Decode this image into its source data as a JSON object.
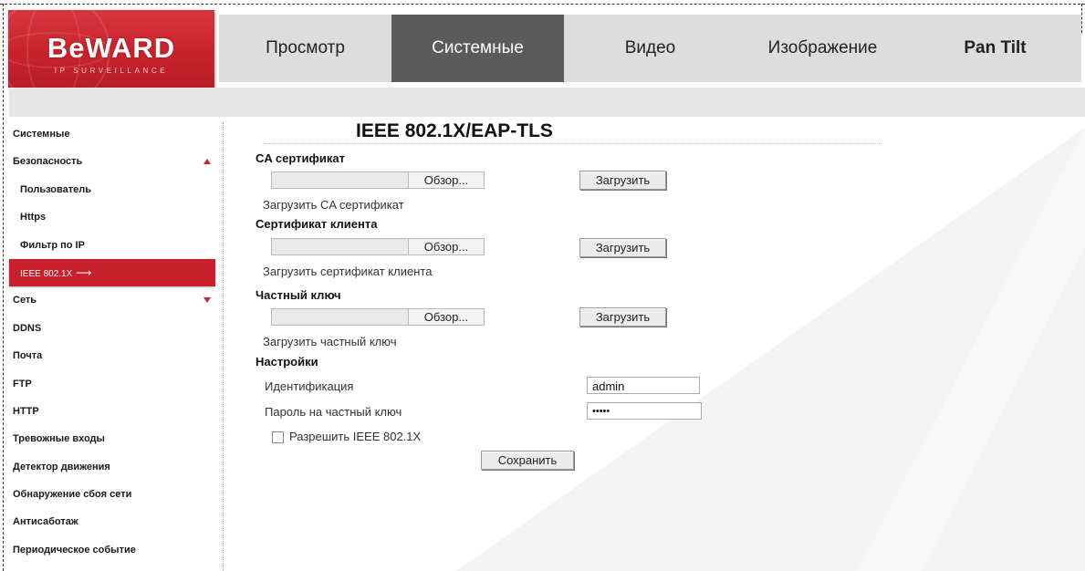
{
  "logo": {
    "text": "BeWARD",
    "subtitle": "IP SURVEILLANCE"
  },
  "nav": {
    "tabs": [
      {
        "label": "Просмотр"
      },
      {
        "label": "Системные"
      },
      {
        "label": "Видео"
      },
      {
        "label": "Изображение"
      },
      {
        "label": "Pan Tilt"
      }
    ],
    "active": "Системные"
  },
  "sidebar": {
    "items": [
      {
        "label": "Системные"
      },
      {
        "label": "Безопасность"
      },
      {
        "label": "Пользователь"
      },
      {
        "label": "Https"
      },
      {
        "label": "Фильтр по IP"
      },
      {
        "label": "IEEE 802.1X"
      },
      {
        "label": "Сеть"
      },
      {
        "label": "DDNS"
      },
      {
        "label": "Почта"
      },
      {
        "label": "FTP"
      },
      {
        "label": "HTTP"
      },
      {
        "label": "Тревожные входы"
      },
      {
        "label": "Детектор движения"
      },
      {
        "label": "Обнаружение сбоя сети"
      },
      {
        "label": "Антисаботаж"
      },
      {
        "label": "Периодическое событие"
      }
    ],
    "arrow_glyph": "⟶"
  },
  "main": {
    "title": "IEEE 802.1X/EAP-TLS",
    "ca": {
      "heading": "CA сертификат",
      "browse": "Обзор...",
      "upload": "Загрузить",
      "hint": "Загрузить CA сертификат"
    },
    "client": {
      "heading": "Сертификат клиента",
      "browse": "Обзор...",
      "upload": "Загрузить",
      "hint": "Загрузить сертификат клиента"
    },
    "key": {
      "heading": "Частный ключ",
      "browse": "Обзор...",
      "upload": "Загрузить",
      "hint": "Загрузить частный ключ"
    },
    "settings": {
      "heading": "Настройки",
      "identity_label": "Идентификация",
      "identity_value": "admin",
      "password_label": "Пароль на частный ключ",
      "password_value": "•••••",
      "enable_label": "Разрешить IEEE 802.1X",
      "enable_checked": false,
      "save": "Сохранить"
    }
  },
  "colors": {
    "brand_red": "#c8202c",
    "nav_active": "#5b5b5b",
    "nav_bg": "#dddddd"
  }
}
